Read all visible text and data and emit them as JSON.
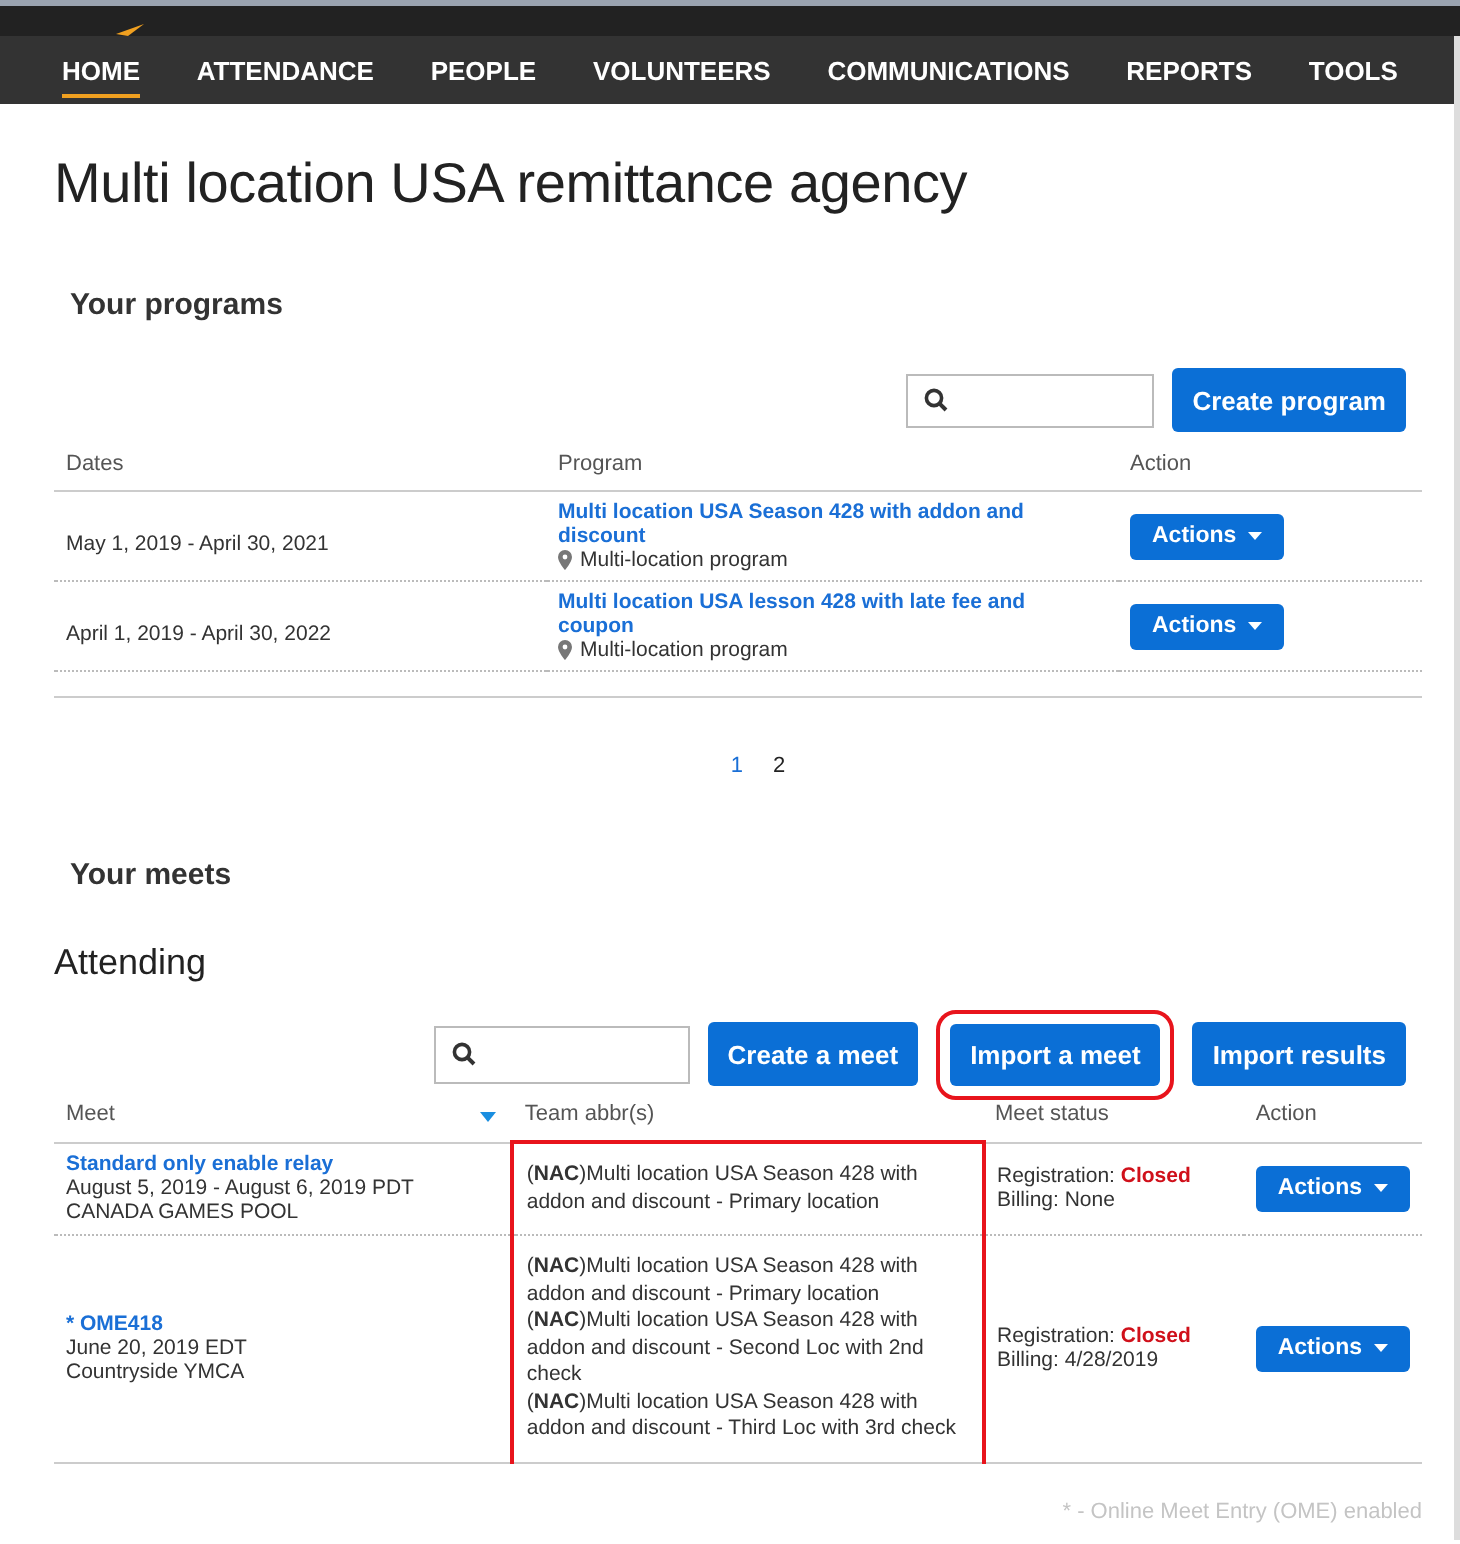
{
  "nav": {
    "items": [
      {
        "label": "HOME",
        "selected": true
      },
      {
        "label": "ATTENDANCE",
        "selected": false
      },
      {
        "label": "PEOPLE",
        "selected": false
      },
      {
        "label": "VOLUNTEERS",
        "selected": false
      },
      {
        "label": "COMMUNICATIONS",
        "selected": false
      },
      {
        "label": "REPORTS",
        "selected": false
      },
      {
        "label": "TOOLS",
        "selected": false
      }
    ]
  },
  "page_title": "Multi location USA remittance agency",
  "programs": {
    "heading": "Your programs",
    "create_button": "Create program",
    "table": {
      "columns": [
        "Dates",
        "Program",
        "Action"
      ],
      "rows": [
        {
          "dates": "May 1, 2019 - April 30, 2021",
          "program": "Multi location USA Season 428 with addon and discount",
          "type": "Multi-location program",
          "action": "Actions"
        },
        {
          "dates": "April 1, 2019 - April 30, 2022",
          "program": "Multi location USA lesson 428 with late fee and coupon",
          "type": "Multi-location program",
          "action": "Actions"
        }
      ]
    },
    "pages": [
      {
        "label": "1",
        "selected": false
      },
      {
        "label": "2",
        "selected": true
      }
    ]
  },
  "meets": {
    "heading": "Your meets",
    "subheading": "Attending",
    "buttons": [
      {
        "label": "Create a meet",
        "highlighted": false
      },
      {
        "label": "Import a meet",
        "highlighted": true
      },
      {
        "label": "Import results",
        "highlighted": false
      }
    ],
    "table": {
      "columns": [
        "Meet",
        "Team abbr(s)",
        "Meet status",
        "Action"
      ],
      "rows": [
        {
          "name": "Standard only enable relay",
          "date": "August 5, 2019 - August 6, 2019 PDT",
          "venue": "CANADA GAMES POOL",
          "teams": [
            "(**NAC**)Multi location USA Season 428 with addon and discount - Primary location"
          ],
          "teams_highlighted": true,
          "registration_label": "Registration:",
          "registration": "Closed",
          "registration_closed": true,
          "billing": "Billing: None",
          "action": "Actions"
        },
        {
          "name": "* OME418",
          "date": "June 20, 2019 EDT",
          "venue": "Countryside YMCA",
          "teams": [
            "(**NAC**)Multi location USA Season 428 with addon and discount - Primary location",
            "(**NAC**)Multi location USA Season 428 with addon and discount - Second Loc with 2nd check",
            "(**NAC**)Multi location USA Season 428 with addon and discount - Third Loc with 3rd check"
          ],
          "teams_highlighted": true,
          "registration_label": "Registration:",
          "registration": "Closed",
          "registration_closed": true,
          "billing": "Billing: 4/28/2019",
          "action": "Actions"
        }
      ]
    },
    "footnote": "* - Online Meet Entry (OME) enabled"
  }
}
